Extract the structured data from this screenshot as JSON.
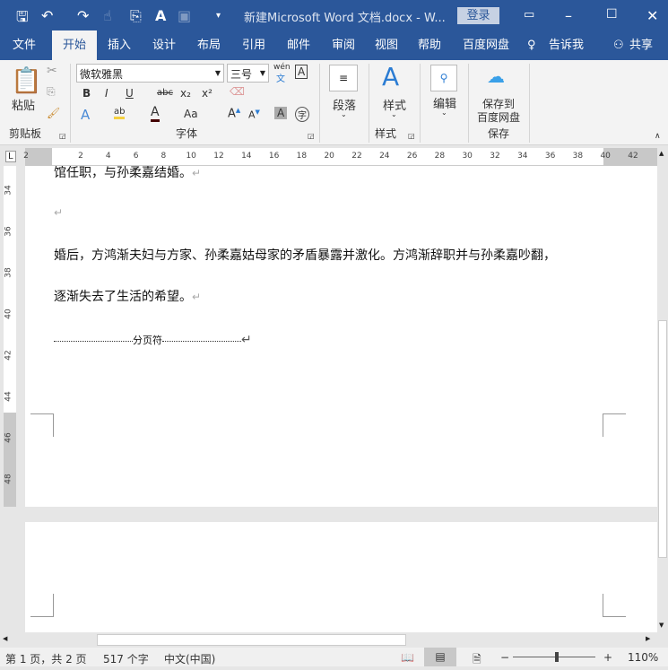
{
  "titlebar": {
    "title": "新建Microsoft Word 文档.docx  -  W...",
    "login": "登录",
    "icons": [
      "save-icon",
      "undo-icon",
      "redo-icon",
      "touch-mode-icon",
      "format-painter-icon",
      "font-color-icon",
      "form-icon",
      "customize-icon"
    ]
  },
  "tabs": [
    "文件",
    "开始",
    "插入",
    "设计",
    "布局",
    "引用",
    "邮件",
    "审阅",
    "视图",
    "帮助",
    "百度网盘"
  ],
  "active_tab": "开始",
  "tellme": "告诉我",
  "share": "共享",
  "ribbon": {
    "clipboard": {
      "paste": "粘贴",
      "group": "剪贴板"
    },
    "font": {
      "name": "微软雅黑",
      "size": "三号",
      "group": "字体",
      "wen": "wén",
      "wen_char": "文",
      "bold": "B",
      "italic": "I",
      "underline": "U",
      "strike": "abc",
      "sub": "x₂",
      "sup": "x²",
      "aa": "Aa",
      "a": "A",
      "char_border": "字"
    },
    "paragraph": {
      "label": "段落"
    },
    "styles": {
      "label": "样式",
      "group": "样式"
    },
    "editing": {
      "label": "编辑"
    },
    "save": {
      "label1": "保存到",
      "label2": "百度网盘",
      "group": "保存"
    }
  },
  "ruler": {
    "h": [
      "2",
      "2",
      "4",
      "6",
      "8",
      "10",
      "12",
      "14",
      "16",
      "18",
      "20",
      "22",
      "24",
      "26",
      "28",
      "30",
      "32",
      "34",
      "36",
      "38",
      "40",
      "42"
    ],
    "v": [
      "34",
      "36",
      "38",
      "40",
      "42",
      "44",
      "46",
      "48"
    ]
  },
  "document": {
    "lines": [
      "馆任职，与孙柔嘉结婚。",
      "",
      "婚后，方鸿渐夫妇与方家、孙柔嘉姑母家的矛盾暴露并激化。方鸿渐辞职并与孙柔嘉吵翻，",
      "逐渐失去了生活的希望。"
    ],
    "para_mark": "↵",
    "page_break": "分页符"
  },
  "status": {
    "page": "第 1 页，共 2 页",
    "words": "517 个字",
    "lang": "中文(中国)",
    "zoom": "110%",
    "zoom_percent": 110
  }
}
